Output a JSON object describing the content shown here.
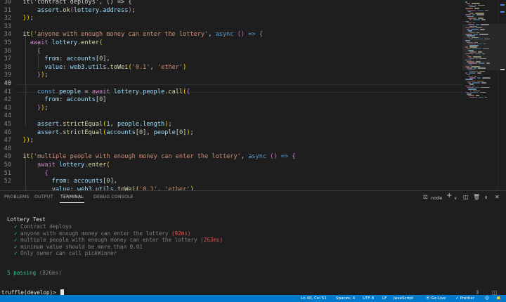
{
  "editor": {
    "line_numbers": [
      "30",
      "31",
      "32",
      "33",
      "34",
      "35",
      "36",
      "37",
      "38",
      "39",
      "40",
      "41",
      "42",
      "43",
      "44",
      "45",
      "46",
      "47",
      "48",
      "49",
      "50",
      "51",
      "52"
    ],
    "active_line": "40",
    "code_lines": [
      [
        {
          "c": "pu",
          "t": "  it('contract deploys', () => {"
        }
      ],
      [
        {
          "c": "pu",
          "t": "      "
        },
        {
          "c": "id",
          "t": "assert"
        },
        {
          "c": "pu",
          "t": "."
        },
        {
          "c": "fn",
          "t": "ok"
        },
        {
          "c": "br2",
          "t": "("
        },
        {
          "c": "id",
          "t": "lottery"
        },
        {
          "c": "pu",
          "t": "."
        },
        {
          "c": "id",
          "t": "address"
        },
        {
          "c": "br2",
          "t": ")"
        },
        {
          "c": "pu",
          "t": ";"
        }
      ],
      [
        {
          "c": "br",
          "t": "  })"
        },
        {
          "c": "pu",
          "t": ";"
        }
      ],
      [
        {
          "c": "pu",
          "t": ""
        }
      ],
      [
        {
          "c": "pu",
          "t": "  "
        },
        {
          "c": "fn",
          "t": "it"
        },
        {
          "c": "br",
          "t": "("
        },
        {
          "c": "st",
          "t": "'anyone with enough money can enter the lottery'"
        },
        {
          "c": "pu",
          "t": ", "
        },
        {
          "c": "kd",
          "t": "async"
        },
        {
          "c": "pu",
          "t": " "
        },
        {
          "c": "br2",
          "t": "()"
        },
        {
          "c": "pu",
          "t": " "
        },
        {
          "c": "kd",
          "t": "=>"
        },
        {
          "c": "pu",
          "t": " "
        },
        {
          "c": "br2",
          "t": "{"
        }
      ],
      [
        {
          "c": "pu",
          "t": "    "
        },
        {
          "c": "kw",
          "t": "await"
        },
        {
          "c": "pu",
          "t": " "
        },
        {
          "c": "id",
          "t": "lottery"
        },
        {
          "c": "pu",
          "t": "."
        },
        {
          "c": "fn",
          "t": "enter"
        },
        {
          "c": "br",
          "t": "("
        }
      ],
      [
        {
          "c": "pu",
          "t": "      "
        },
        {
          "c": "br2",
          "t": "{"
        }
      ],
      [
        {
          "c": "pu",
          "t": "        "
        },
        {
          "c": "id",
          "t": "from"
        },
        {
          "c": "pu",
          "t": ": "
        },
        {
          "c": "id",
          "t": "accounts"
        },
        {
          "c": "pu",
          "t": "["
        },
        {
          "c": "nu",
          "t": "0"
        },
        {
          "c": "pu",
          "t": "],"
        }
      ],
      [
        {
          "c": "pu",
          "t": "        "
        },
        {
          "c": "id",
          "t": "value"
        },
        {
          "c": "pu",
          "t": ": "
        },
        {
          "c": "id",
          "t": "web3"
        },
        {
          "c": "pu",
          "t": "."
        },
        {
          "c": "id",
          "t": "utils"
        },
        {
          "c": "pu",
          "t": "."
        },
        {
          "c": "fn",
          "t": "toWei"
        },
        {
          "c": "br",
          "t": "("
        },
        {
          "c": "st",
          "t": "'0.1'"
        },
        {
          "c": "pu",
          "t": ", "
        },
        {
          "c": "st",
          "t": "'ether'"
        },
        {
          "c": "br",
          "t": ")"
        }
      ],
      [
        {
          "c": "pu",
          "t": "      "
        },
        {
          "c": "br2",
          "t": "}"
        },
        {
          "c": "br",
          "t": ")"
        },
        {
          "c": "pu",
          "t": ";"
        }
      ],
      [
        {
          "c": "pu",
          "t": ""
        }
      ],
      [
        {
          "c": "pu",
          "t": "      "
        },
        {
          "c": "kd",
          "t": "const"
        },
        {
          "c": "pu",
          "t": " "
        },
        {
          "c": "id",
          "t": "people"
        },
        {
          "c": "pu",
          "t": " = "
        },
        {
          "c": "kw",
          "t": "await"
        },
        {
          "c": "pu",
          "t": " "
        },
        {
          "c": "id",
          "t": "lottery"
        },
        {
          "c": "pu",
          "t": "."
        },
        {
          "c": "id",
          "t": "people"
        },
        {
          "c": "pu",
          "t": "."
        },
        {
          "c": "fn",
          "t": "call"
        },
        {
          "c": "br",
          "t": "("
        },
        {
          "c": "br2",
          "t": "{"
        }
      ],
      [
        {
          "c": "pu",
          "t": "        "
        },
        {
          "c": "id",
          "t": "from"
        },
        {
          "c": "pu",
          "t": ": "
        },
        {
          "c": "id",
          "t": "accounts"
        },
        {
          "c": "pu",
          "t": "["
        },
        {
          "c": "nu",
          "t": "0"
        },
        {
          "c": "pu",
          "t": "]"
        }
      ],
      [
        {
          "c": "pu",
          "t": "      "
        },
        {
          "c": "br2",
          "t": "}"
        },
        {
          "c": "br",
          "t": ")"
        },
        {
          "c": "pu",
          "t": ";"
        }
      ],
      [
        {
          "c": "pu",
          "t": ""
        }
      ],
      [
        {
          "c": "pu",
          "t": "      "
        },
        {
          "c": "id",
          "t": "assert"
        },
        {
          "c": "pu",
          "t": "."
        },
        {
          "c": "fn",
          "t": "strictEqual"
        },
        {
          "c": "br",
          "t": "("
        },
        {
          "c": "nu",
          "t": "1"
        },
        {
          "c": "pu",
          "t": ", "
        },
        {
          "c": "id",
          "t": "people"
        },
        {
          "c": "pu",
          "t": "."
        },
        {
          "c": "id",
          "t": "length"
        },
        {
          "c": "br",
          "t": ")"
        },
        {
          "c": "pu",
          "t": ";"
        }
      ],
      [
        {
          "c": "pu",
          "t": "      "
        },
        {
          "c": "id",
          "t": "assert"
        },
        {
          "c": "pu",
          "t": "."
        },
        {
          "c": "fn",
          "t": "strictEqual"
        },
        {
          "c": "br",
          "t": "("
        },
        {
          "c": "id",
          "t": "accounts"
        },
        {
          "c": "pu",
          "t": "["
        },
        {
          "c": "nu",
          "t": "0"
        },
        {
          "c": "pu",
          "t": "], "
        },
        {
          "c": "id",
          "t": "people"
        },
        {
          "c": "pu",
          "t": "["
        },
        {
          "c": "nu",
          "t": "0"
        },
        {
          "c": "pu",
          "t": "]"
        },
        {
          "c": "br",
          "t": ")"
        },
        {
          "c": "pu",
          "t": ";"
        }
      ],
      [
        {
          "c": "br",
          "t": "  })"
        },
        {
          "c": "pu",
          "t": ";"
        }
      ],
      [
        {
          "c": "pu",
          "t": ""
        }
      ],
      [
        {
          "c": "pu",
          "t": "  "
        },
        {
          "c": "fn",
          "t": "it"
        },
        {
          "c": "br",
          "t": "("
        },
        {
          "c": "st",
          "t": "'multiple people with enough money can enter the lottery'"
        },
        {
          "c": "pu",
          "t": ", "
        },
        {
          "c": "kd",
          "t": "async"
        },
        {
          "c": "pu",
          "t": " "
        },
        {
          "c": "br2",
          "t": "()"
        },
        {
          "c": "pu",
          "t": " "
        },
        {
          "c": "kd",
          "t": "=>"
        },
        {
          "c": "pu",
          "t": " "
        },
        {
          "c": "br2",
          "t": "{"
        }
      ],
      [
        {
          "c": "pu",
          "t": "      "
        },
        {
          "c": "kw",
          "t": "await"
        },
        {
          "c": "pu",
          "t": " "
        },
        {
          "c": "id",
          "t": "lottery"
        },
        {
          "c": "pu",
          "t": "."
        },
        {
          "c": "fn",
          "t": "enter"
        },
        {
          "c": "br",
          "t": "("
        }
      ],
      [
        {
          "c": "pu",
          "t": "        "
        },
        {
          "c": "br2",
          "t": "{"
        }
      ],
      [
        {
          "c": "pu",
          "t": "          "
        },
        {
          "c": "id",
          "t": "from"
        },
        {
          "c": "pu",
          "t": ": "
        },
        {
          "c": "id",
          "t": "accounts"
        },
        {
          "c": "pu",
          "t": "["
        },
        {
          "c": "nu",
          "t": "0"
        },
        {
          "c": "pu",
          "t": "],"
        }
      ],
      [
        {
          "c": "pu",
          "t": "          "
        },
        {
          "c": "id",
          "t": "value"
        },
        {
          "c": "pu",
          "t": ": "
        },
        {
          "c": "id",
          "t": "web3"
        },
        {
          "c": "pu",
          "t": "."
        },
        {
          "c": "id",
          "t": "utils"
        },
        {
          "c": "pu",
          "t": "."
        },
        {
          "c": "fn",
          "t": "toWei"
        },
        {
          "c": "br",
          "t": "("
        },
        {
          "c": "st",
          "t": "'0.1'"
        },
        {
          "c": "pu",
          "t": ", "
        },
        {
          "c": "st",
          "t": "'ether'"
        },
        {
          "c": "br",
          "t": ")"
        }
      ]
    ]
  },
  "panel": {
    "tabs": [
      "PROBLEMS",
      "OUTPUT",
      "TERMINAL",
      "DEBUG CONSOLE"
    ],
    "active_tab": "TERMINAL",
    "shell_label": "node",
    "icons": {
      "terminal": "terminal-icon",
      "add": "plus-icon",
      "split": "split-terminal-icon",
      "trash": "trash-icon",
      "maximize": "chevron-up-icon",
      "close": "close-icon"
    }
  },
  "terminal": {
    "suite_title": "Lottery Test",
    "tests": [
      {
        "check": "✓",
        "name": "Contract deploys",
        "time": ""
      },
      {
        "check": "✓",
        "name": "anyone with enough money can enter the lottery",
        "time": "(92ms)"
      },
      {
        "check": "✓",
        "name": "multiple people with enough money can enter the lottery",
        "time": "(263ms)"
      },
      {
        "check": "✓",
        "name": "minimum value should be more than 0.01",
        "time": ""
      },
      {
        "check": "✓",
        "name": "Only owner can call pickWinner",
        "time": ""
      }
    ],
    "summary": "5 passing",
    "summary_time": "(826ms)",
    "prompt": "truffle(develop)> "
  },
  "status_bar": {
    "items": [
      "Ln 40, Col 51",
      "Spaces: 4",
      "UTF-8",
      "LF",
      "JavaScript",
      "Go Live",
      "Prettier"
    ],
    "accent": "#007acc"
  },
  "colors": {
    "editor_bg": "#1e1e1e",
    "check_green": "#23d18b",
    "slow_red": "#f14c4c"
  }
}
